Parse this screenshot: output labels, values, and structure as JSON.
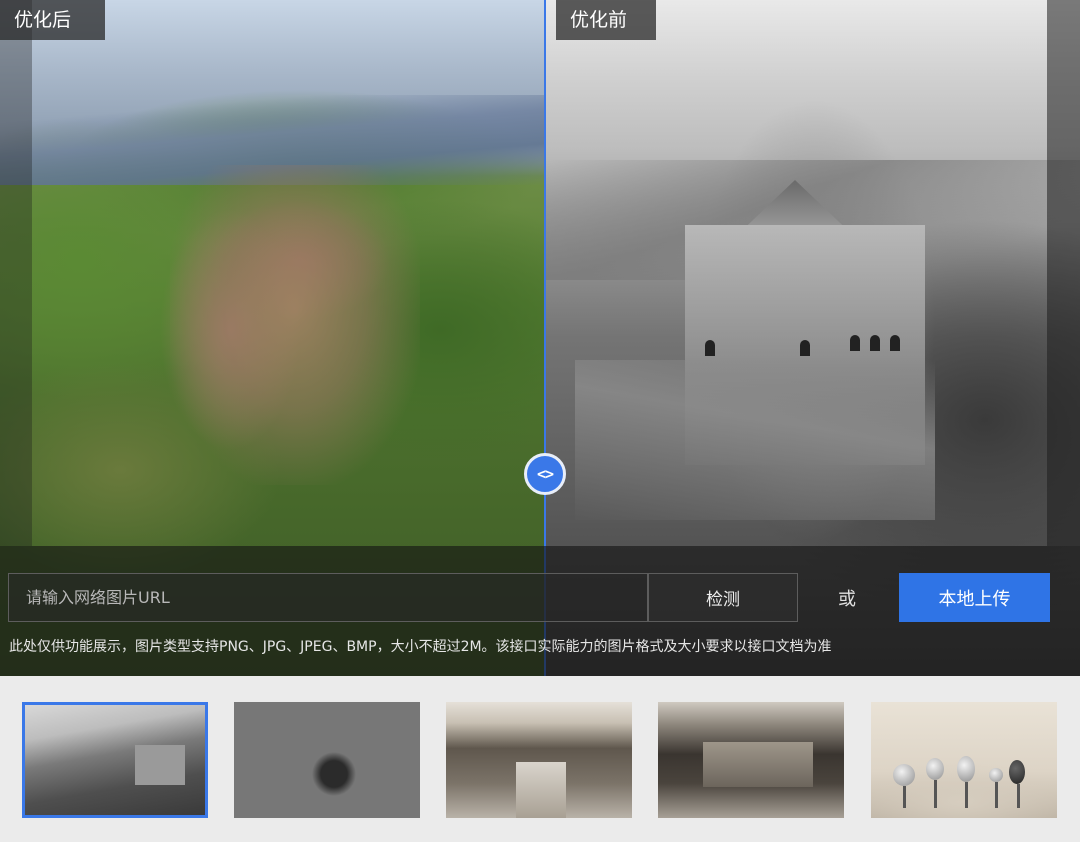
{
  "compare": {
    "after_label": "优化后",
    "before_label": "优化前",
    "handle_glyph": "<>",
    "divider_color": "#3a78e8"
  },
  "controls": {
    "url_placeholder": "请输入网络图片URL",
    "detect_label": "检测",
    "or_label": "或",
    "upload_label": "本地上传",
    "upload_color": "#2f74e6"
  },
  "notice": "此处仅供功能展示，图片类型支持PNG、JPG、JPEG、BMP，大小不超过2M。该接口实际能力的图片格式及大小要求以接口文档为准",
  "samples": {
    "items": [
      {
        "icon": "great-wall-thumbnail",
        "active": true
      },
      {
        "icon": "girl-with-camera-thumbnail",
        "active": false
      },
      {
        "icon": "old-street-thumbnail",
        "active": false
      },
      {
        "icon": "storefront-thumbnail",
        "active": false
      },
      {
        "icon": "microphones-thumbnail",
        "active": false
      }
    ]
  }
}
